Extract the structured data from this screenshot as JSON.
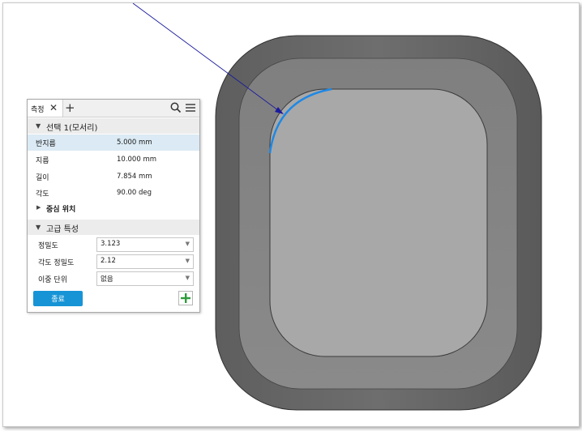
{
  "panel": {
    "tab_label": "측정",
    "close_glyph": "✕",
    "add_glyph": "+",
    "icons": [
      "search-icon",
      "menu-icon"
    ],
    "selection": {
      "header": "선택 1(모서리)",
      "rows": [
        {
          "key": "반지름",
          "value": "5.000 mm"
        },
        {
          "key": "지름",
          "value": "10.000 mm"
        },
        {
          "key": "길이",
          "value": "7.854 mm"
        },
        {
          "key": "각도",
          "value": "90.00 deg"
        }
      ],
      "center_position_label": "중심 위치"
    },
    "advanced": {
      "header": "고급 특성",
      "rows": [
        {
          "key": "정밀도",
          "value": "3.123"
        },
        {
          "key": "각도 정밀도",
          "value": "2.12"
        },
        {
          "key": "이중 단위",
          "value": "없음"
        }
      ]
    },
    "done_label": "종료",
    "add_measure_glyph": "+"
  },
  "colors": {
    "accent": "#1794d6",
    "highlight_edge": "#1e88e5",
    "leader_line": "#1a1a9e",
    "add_green": "#2e9b3c"
  }
}
